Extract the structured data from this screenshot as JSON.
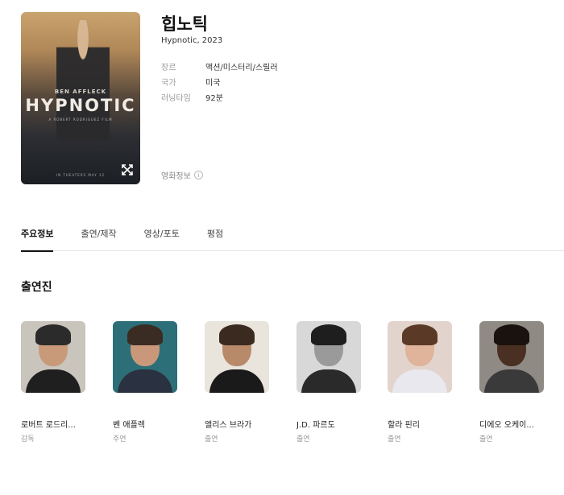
{
  "movie": {
    "title": "힙노틱",
    "subtitle": "Hypnotic, 2023",
    "meta": [
      {
        "label": "장르",
        "value": "액션/미스터리/스릴러"
      },
      {
        "label": "국가",
        "value": "미국"
      },
      {
        "label": "러닝타임",
        "value": "92분"
      }
    ],
    "info_link": "영화정보",
    "info_icon": "i"
  },
  "poster": {
    "actor": "BEN AFFLECK",
    "title": "HYPNOTIC",
    "tagline": "A ROBERT RODRIGUEZ FILM",
    "date": "IN THEATERS MAY 12"
  },
  "tabs": [
    {
      "label": "주요정보",
      "active": true
    },
    {
      "label": "출연/제작",
      "active": false
    },
    {
      "label": "영상/포토",
      "active": false
    },
    {
      "label": "평점",
      "active": false
    }
  ],
  "cast_section_title": "출연진",
  "cast": [
    {
      "name": "로버트 로드리...",
      "role": "감독",
      "bg": "#c9c4bc",
      "skin": "#c89a7a",
      "hair": "#2b2b2b",
      "cloth": "#1f1f1f"
    },
    {
      "name": "벤 애플렉",
      "role": "주연",
      "bg": "#2d6f78",
      "skin": "#c9987a",
      "hair": "#3a2c22",
      "cloth": "#2a3140"
    },
    {
      "name": "앨리스 브라가",
      "role": "출연",
      "bg": "#e9e4dc",
      "skin": "#b98a6a",
      "hair": "#3b2a20",
      "cloth": "#1a1a1a"
    },
    {
      "name": "J.D. 파르도",
      "role": "출연",
      "bg": "#d8d8d8",
      "skin": "#9a9a9a",
      "hair": "#1e1e1e",
      "cloth": "#2a2a2a"
    },
    {
      "name": "할라 핀리",
      "role": "출연",
      "bg": "#e2d4cc",
      "skin": "#e0b49a",
      "hair": "#5a3a26",
      "cloth": "#e8e8ee"
    },
    {
      "name": "디에오 오케이...",
      "role": "출연",
      "bg": "#8f8a84",
      "skin": "#4a3022",
      "hair": "#1a120e",
      "cloth": "#3a3a3a"
    }
  ]
}
